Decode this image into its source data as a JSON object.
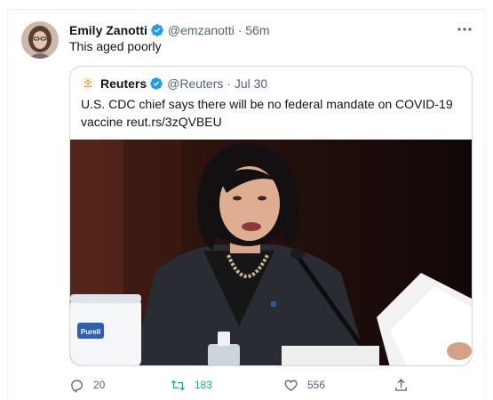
{
  "tweet": {
    "author_name": "Emily Zanotti",
    "handle_time": "@emzanotti · 56m",
    "text": "This aged poorly",
    "more_icon": "more-horizontal-icon"
  },
  "quote": {
    "author_name": "Reuters",
    "handle_time": "@Reuters · Jul 30",
    "text": "U.S. CDC chief says there will be no federal mandate on COVID-19 vaccine reut.rs/3zQVBEU",
    "image_label": "Purell"
  },
  "actions": {
    "replies": "20",
    "retweets": "183",
    "likes": "556"
  },
  "colors": {
    "verified": "#1d9bf0",
    "retweet": "#00ba7c",
    "muted": "#536471"
  }
}
